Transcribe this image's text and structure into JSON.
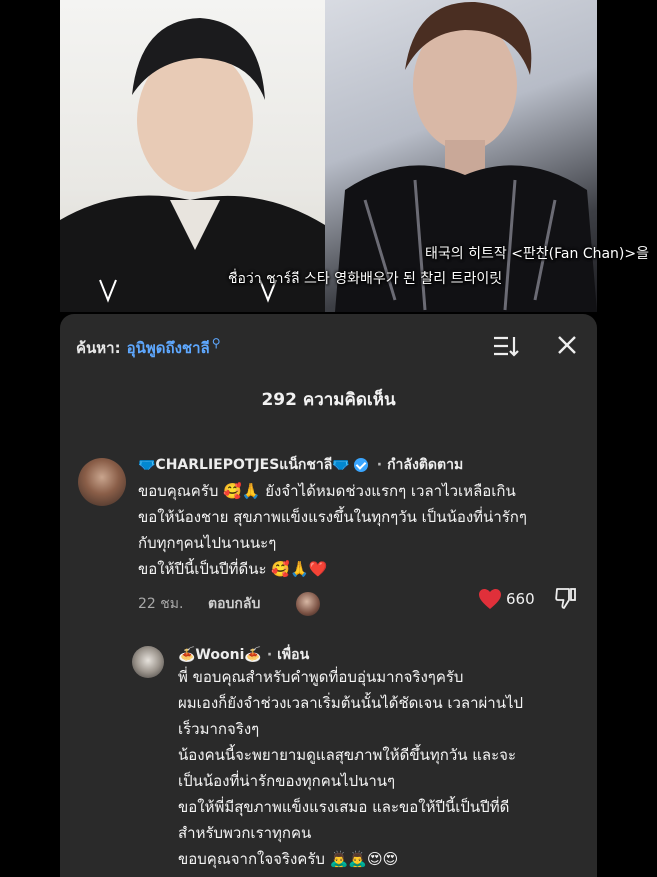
{
  "video": {
    "subtitle_line1": "태국의 히트작 <판찬(Fan Chan)>을",
    "subtitle_line2": "ชื่อว่า ชาร์ลี  스타 영화배우가 된 찰리 트라이릿"
  },
  "comments_sheet": {
    "search_prefix": "ค้นหา:",
    "search_term": "อุนิพูดถึงชาลี",
    "title": "292 ความคิดเห็น",
    "icons": {
      "search": "search-icon",
      "sort": "sort-icon",
      "close": "close-icon"
    }
  },
  "comment": {
    "username": "🩲CHARLIEPOTJESแน็กชาลี🩲",
    "verified_icon": "verified-badge-icon",
    "follow_status": "กำลังติดตาม",
    "lines": [
      "ขอบคุณครับ 🥰🙏 ยังจำได้หมดช่วงแรกๆ เวลาไวเหลือเกิน",
      "ขอให้น้องชาย สุขภาพแข็งแรงขึ้นในทุกๆวัน เป็นน้องที่น่ารักๆ",
      "กับทุกๆคนไปนานนะๆ",
      "ขอให้ปีนี้เป็นปีที่ดีนะ 🥰🙏❤️"
    ],
    "time": "22 ชม.",
    "reply_label": "ตอบกลับ",
    "like_count": "660",
    "heart_color": "#e0303a"
  },
  "reply": {
    "username": "🍝Wooni🍝",
    "relation": "เพื่อน",
    "lines": [
      "พี่ ขอบคุณสำหรับคำพูดที่อบอุ่นมากจริงๆครับ",
      "ผมเองก็ยังจำช่วงเวลาเริ่มต้นนั้นได้ชัดเจน เวลาผ่านไป",
      "เร็วมากจริงๆ",
      "น้องคนนี้จะพยายามดูแลสุขภาพให้ดีขึ้นทุกวัน และจะ",
      "เป็นน้องที่น่ารักของทุกคนไปนานๆ",
      "ขอให้พี่มีสุขภาพแข็งแรงเสมอ และขอให้ปีนี้เป็นปีที่ดี",
      "สำหรับพวกเราทุกคน",
      "ขอบคุณจากใจจริงครับ 🙇‍♂️🙇‍♂️😍😍"
    ]
  }
}
